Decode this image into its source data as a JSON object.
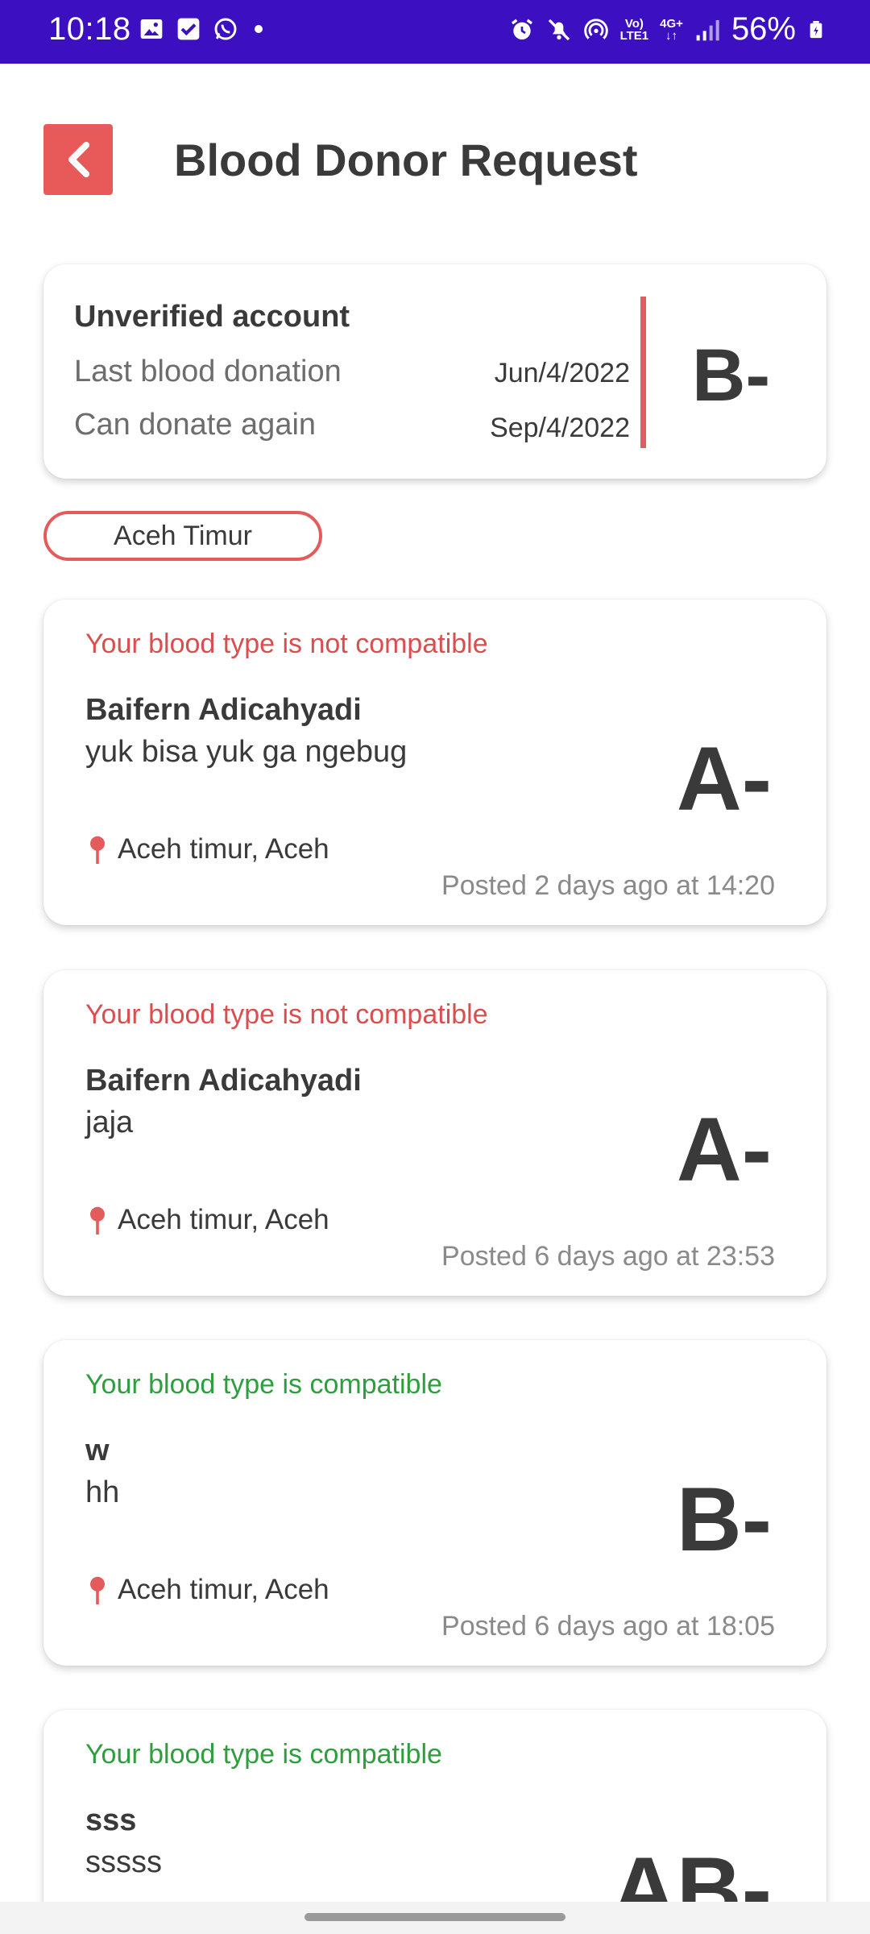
{
  "status_bar": {
    "time": "10:18",
    "battery": "56%",
    "network_top": "Vo)",
    "network_bottom": "LTE1",
    "gen_top": "4G+",
    "left_icons": [
      "gallery-icon",
      "check-square-icon",
      "whatsapp-icon",
      "dot-icon"
    ],
    "right_icons": [
      "alarm-icon",
      "mute-icon",
      "hotspot-icon",
      "signal-icon",
      "battery-icon"
    ]
  },
  "header": {
    "title": "Blood Donor Request",
    "back_icon": "chevron-left-icon"
  },
  "donor": {
    "status": "Unverified account",
    "last_donation_label": "Last blood donation",
    "last_donation_value": "Jun/4/2022",
    "next_donation_label": "Can donate again",
    "next_donation_value": "Sep/4/2022",
    "blood_type": "B-"
  },
  "location_filter": "Aceh Timur",
  "requests": [
    {
      "compatibility": "Your blood type is not compatible",
      "compatible": false,
      "name": "Baifern Adicahyadi",
      "message": "yuk bisa yuk ga ngebug",
      "blood_type": "A-",
      "location": "Aceh timur, Aceh",
      "posted": "Posted 2 days ago at 14:20"
    },
    {
      "compatibility": "Your blood type is not compatible",
      "compatible": false,
      "name": "Baifern Adicahyadi",
      "message": "jaja",
      "blood_type": "A-",
      "location": "Aceh timur, Aceh",
      "posted": "Posted 6 days ago at 23:53"
    },
    {
      "compatibility": "Your blood type is compatible",
      "compatible": true,
      "name": "w",
      "message": "hh",
      "blood_type": "B-",
      "location": "Aceh timur, Aceh",
      "posted": "Posted 6 days ago at 18:05"
    },
    {
      "compatibility": "Your blood type is compatible",
      "compatible": true,
      "name": "sss",
      "message": "sssss",
      "blood_type": "AB-"
    }
  ],
  "colors": {
    "status_bar": "#3c0fc0",
    "accent": "#e85a5a",
    "compatible": "#2e9e3e",
    "not_compatible": "#d94f4f"
  }
}
